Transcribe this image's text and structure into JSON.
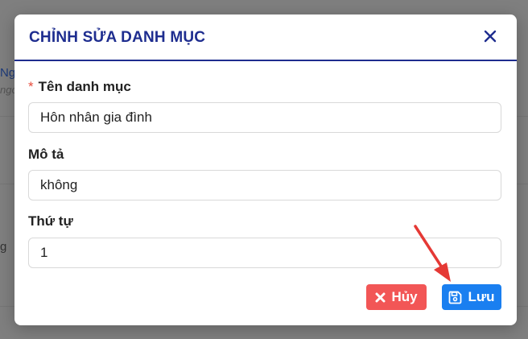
{
  "background": {
    "fragment_1": "Ng",
    "fragment_2": "ngo",
    "fragment_3": "g"
  },
  "modal": {
    "title": "CHỈNH SỬA DANH MỤC",
    "close_icon": "close-icon",
    "accent_color": "#1e2d8f"
  },
  "form": {
    "name": {
      "required_marker": "*",
      "label": "Tên danh mục",
      "value": "Hôn nhân gia đình"
    },
    "description": {
      "label": "Mô tả",
      "value": "không"
    },
    "order": {
      "label": "Thứ tự",
      "value": "1"
    }
  },
  "actions": {
    "cancel_label": "Hủy",
    "cancel_icon": "close-icon",
    "cancel_color": "#f25656",
    "save_label": "Lưu",
    "save_icon": "save-icon",
    "save_color": "#1a7ff0"
  },
  "annotation": {
    "arrow_color": "#e53935"
  }
}
